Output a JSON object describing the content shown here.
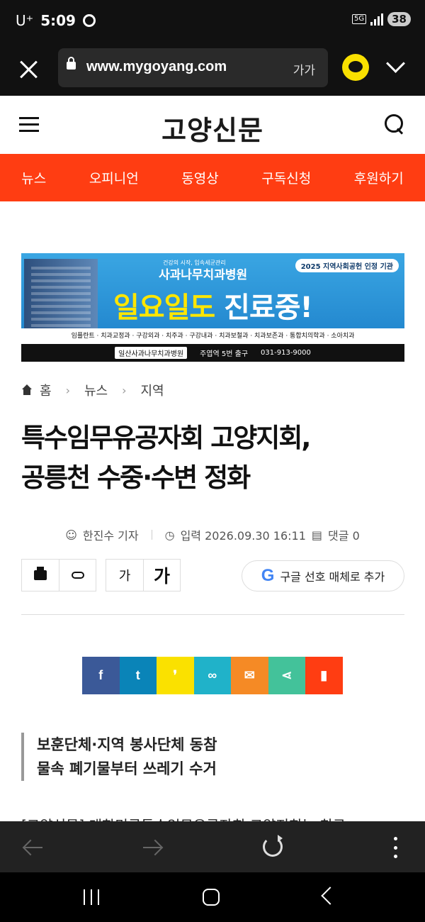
{
  "status_bar": {
    "carrier": "U⁺",
    "time": "5:09",
    "network": "5G",
    "battery": "38"
  },
  "browser": {
    "url": "www.mygoyang.com",
    "text_size": "가가"
  },
  "site": {
    "logo": "고양신문"
  },
  "nav": {
    "items": [
      "뉴스",
      "오피니언",
      "동영상",
      "구독신청",
      "후원하기"
    ]
  },
  "ad": {
    "tagline": "건강의 시작, 입속세균관리",
    "hospital": "사과나무치과병원",
    "badge": "2025 지역사회공헌 인정 기관",
    "headline_part1": "일요일도",
    "headline_part2": "진료중!",
    "services": "임플란트 · 치과교정과 · 구강외과 · 치주과 · 구강내과 · 치과보철과 · 치과보존과 · 통합치의학과 · 소아치과",
    "search_term": "일산사과나무치과병원",
    "station": "주엽역 5번 출구",
    "phone": "031-913-9000"
  },
  "breadcrumb": {
    "home": "홈",
    "level1": "뉴스",
    "level2": "지역"
  },
  "article": {
    "title_line1": "특수임무유공자회 고양지회,",
    "title_line2": "공릉천 수중·수변 정화",
    "author": "한진수 기자",
    "date": "입력 2026.09.30 16:11",
    "comments": "댓글 0",
    "summary_line1": "보훈단체·지역 봉사단체 동참",
    "summary_line2": "물속 폐기물부터 쓰레기 수거",
    "body_peek": "[고양신문] 대한민국특수임무유공자회 고양지회는 최근"
  },
  "tools": {
    "font_small": "가",
    "font_large": "가",
    "google_label": "구글 선호 매체로 추가"
  },
  "share": {
    "buttons": [
      {
        "label": "f",
        "color": "#3b5998"
      },
      {
        "label": "t",
        "color": "#0a84b8"
      },
      {
        "label": "❜",
        "color": "#fae100"
      },
      {
        "label": "∞",
        "color": "#20b2c9"
      },
      {
        "label": "✉",
        "color": "#f58a25"
      },
      {
        "label": "⋖",
        "color": "#43c29a"
      },
      {
        "label": "▮",
        "color": "#ff3d12"
      }
    ]
  }
}
